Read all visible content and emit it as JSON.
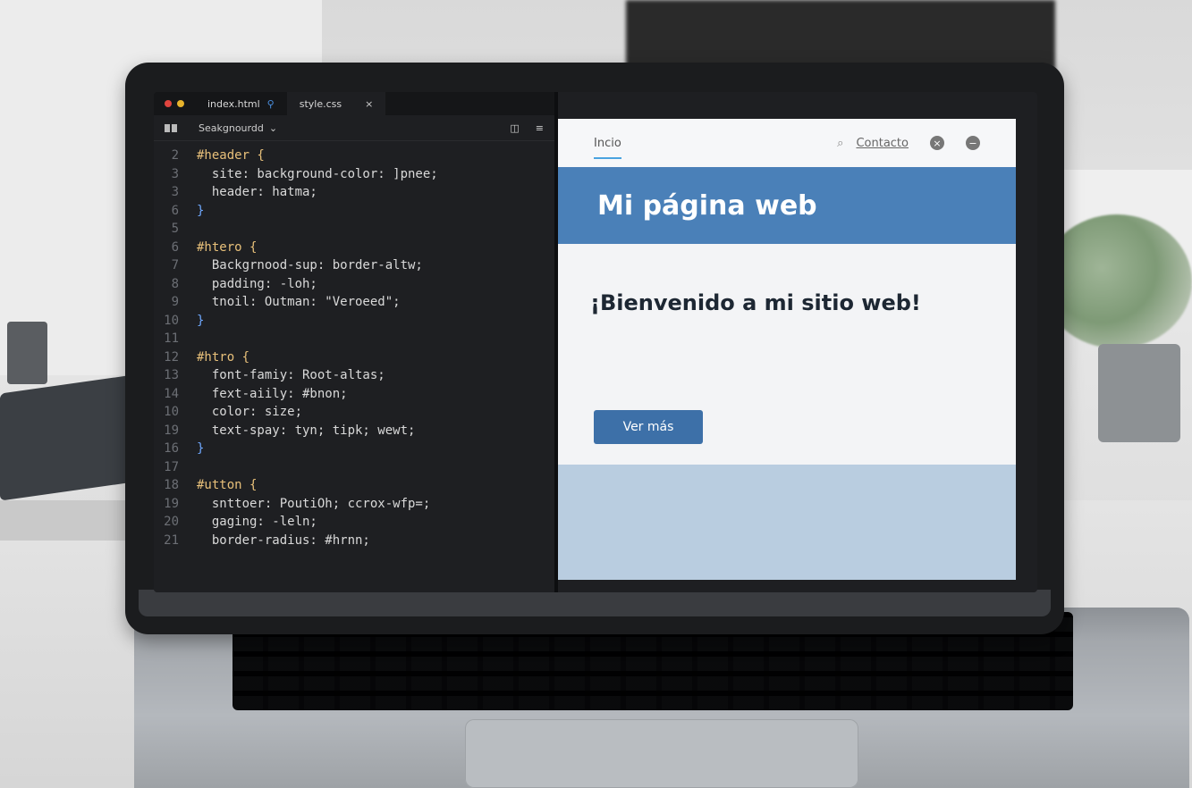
{
  "editor": {
    "tabs": [
      {
        "label": "index.html"
      },
      {
        "label": "style.css"
      }
    ],
    "close_glyph": "×",
    "toolbar": {
      "select_label": "Seakgnourdd",
      "select_chevron": "⌄"
    },
    "lines": [
      {
        "n": "2",
        "text": "#header {"
      },
      {
        "n": "3",
        "text": "  site: background-color: ]pnee;"
      },
      {
        "n": "3",
        "text": "  header: hatma;"
      },
      {
        "n": "6",
        "text": "}"
      },
      {
        "n": "5",
        "text": ""
      },
      {
        "n": "6",
        "text": "#htero {"
      },
      {
        "n": "7",
        "text": "  Backgrnood-sup: border-altw;"
      },
      {
        "n": "8",
        "text": "  padding: -loh;"
      },
      {
        "n": "9",
        "text": "  tnoil: Outman: \"Veroeed\";"
      },
      {
        "n": "10",
        "text": "}"
      },
      {
        "n": "11",
        "text": ""
      },
      {
        "n": "12",
        "text": "#htro {"
      },
      {
        "n": "13",
        "text": "  font-famiy: Root-altas;"
      },
      {
        "n": "14",
        "text": "  fext-aiily: #bnon;"
      },
      {
        "n": "10",
        "text": "  color: size;"
      },
      {
        "n": "19",
        "text": "  text-spay: tyn; tipk; wewt;"
      },
      {
        "n": "16",
        "text": "}"
      },
      {
        "n": "17",
        "text": ""
      },
      {
        "n": "18",
        "text": "#utton {"
      },
      {
        "n": "19",
        "text": "  snttoer: PoutiOh; ccrox-wfp=;"
      },
      {
        "n": "20",
        "text": "  gaging: -leln;"
      },
      {
        "n": "21",
        "text": "  border-radius: #hrnn;"
      }
    ]
  },
  "preview": {
    "nav": {
      "home": "Incio",
      "contact": "Contacto",
      "search_glyph": "⌕",
      "close_glyph": "×",
      "minus_glyph": "−"
    },
    "hero_title": "Mi página web",
    "welcome": "¡Bienvenido a mi sitio web!",
    "cta": "Ver más"
  },
  "colors": {
    "hero": "#4a80b8",
    "button": "#3d70a8",
    "accent": "#4aa3e0"
  }
}
